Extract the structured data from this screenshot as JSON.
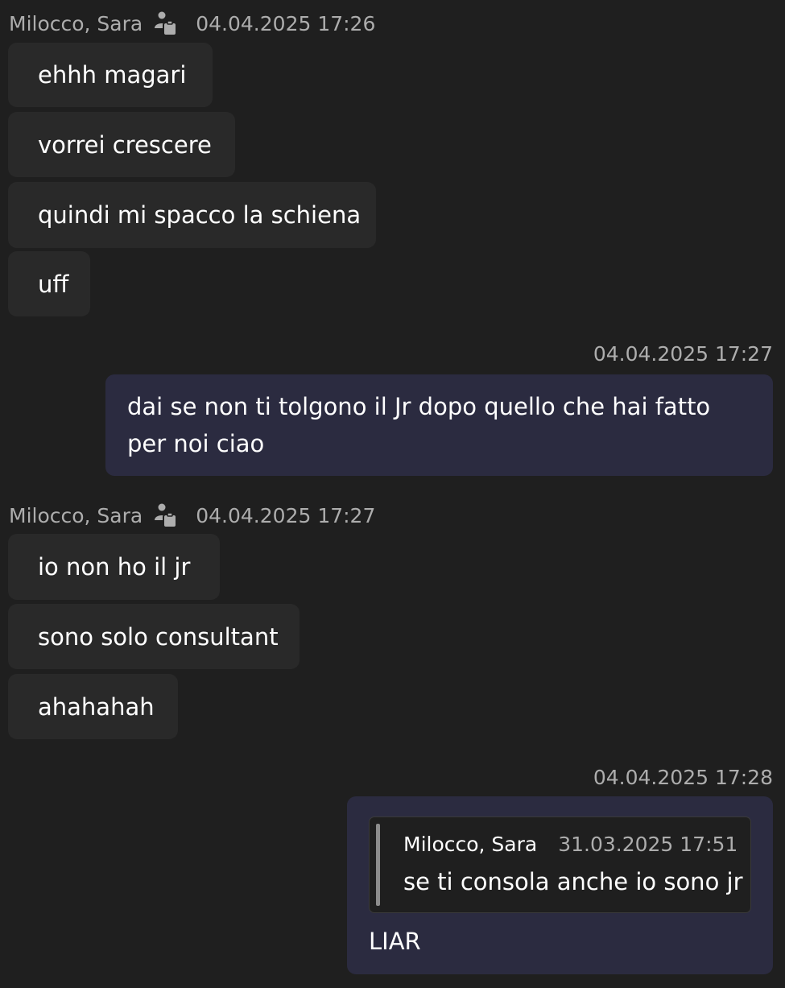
{
  "groups": [
    {
      "sender": "Milocco, Sara",
      "icon": "org-person-icon",
      "timestamp": "04.04.2025 17:26",
      "messages": [
        "ehhh magari",
        "vorrei crescere",
        "quindi mi spacco la schiena",
        "uff"
      ]
    },
    {
      "sender": "",
      "timestamp": "04.04.2025 17:27",
      "messages": [
        "dai se non ti tolgono il Jr dopo quello che hai fatto per noi ciao"
      ]
    },
    {
      "sender": "Milocco, Sara",
      "icon": "org-person-icon",
      "timestamp": "04.04.2025 17:27",
      "messages": [
        "io non ho il jr",
        "sono solo consultant",
        "ahahahah"
      ]
    },
    {
      "sender": "",
      "timestamp": "04.04.2025 17:28",
      "quote": {
        "sender": "Milocco, Sara",
        "timestamp": "31.03.2025 17:51",
        "text": "se ti consola anche io sono jr"
      },
      "messages": [
        "LIAR"
      ]
    }
  ],
  "colors": {
    "background": "#1f1f1f",
    "incoming_bubble": "#292929",
    "outgoing_bubble": "#2b2b40",
    "meta_text": "#adadad"
  }
}
